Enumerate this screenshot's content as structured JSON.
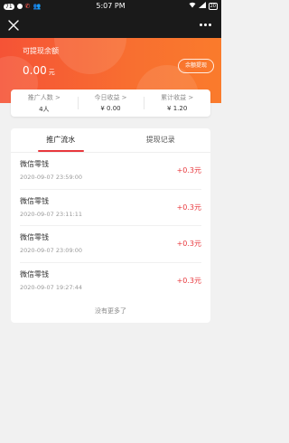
{
  "status_bar": {
    "badge_count": "71",
    "time": "5:07 PM",
    "battery": "20"
  },
  "hero": {
    "label": "可提现余额",
    "amount": "0.00",
    "unit": "元",
    "withdraw_button": "余额提现"
  },
  "stats": [
    {
      "label": "推广人数 >",
      "value": "4人"
    },
    {
      "label": "今日收益 >",
      "value": "¥ 0.00"
    },
    {
      "label": "累计收益 >",
      "value": "¥ 1.20"
    }
  ],
  "tabs": [
    {
      "label": "推广流水",
      "active": true
    },
    {
      "label": "提现记录",
      "active": false
    }
  ],
  "records": [
    {
      "title": "微信零钱",
      "time": "2020-09-07 23:59:00",
      "amount": "+0.3元"
    },
    {
      "title": "微信零钱",
      "time": "2020-09-07 23:11:11",
      "amount": "+0.3元"
    },
    {
      "title": "微信零钱",
      "time": "2020-09-07 23:09:00",
      "amount": "+0.3元"
    },
    {
      "title": "微信零钱",
      "time": "2020-09-07 19:27:44",
      "amount": "+0.3元"
    }
  ],
  "no_more": "没有更多了",
  "colors": {
    "accent_red": "#e8383d",
    "hero_start": "#f55336",
    "hero_end": "#fa7b2c",
    "bar_dark": "#1a1a1a"
  },
  "icons": {
    "nav_close": "close-icon",
    "nav_more": "more-dots-icon"
  }
}
